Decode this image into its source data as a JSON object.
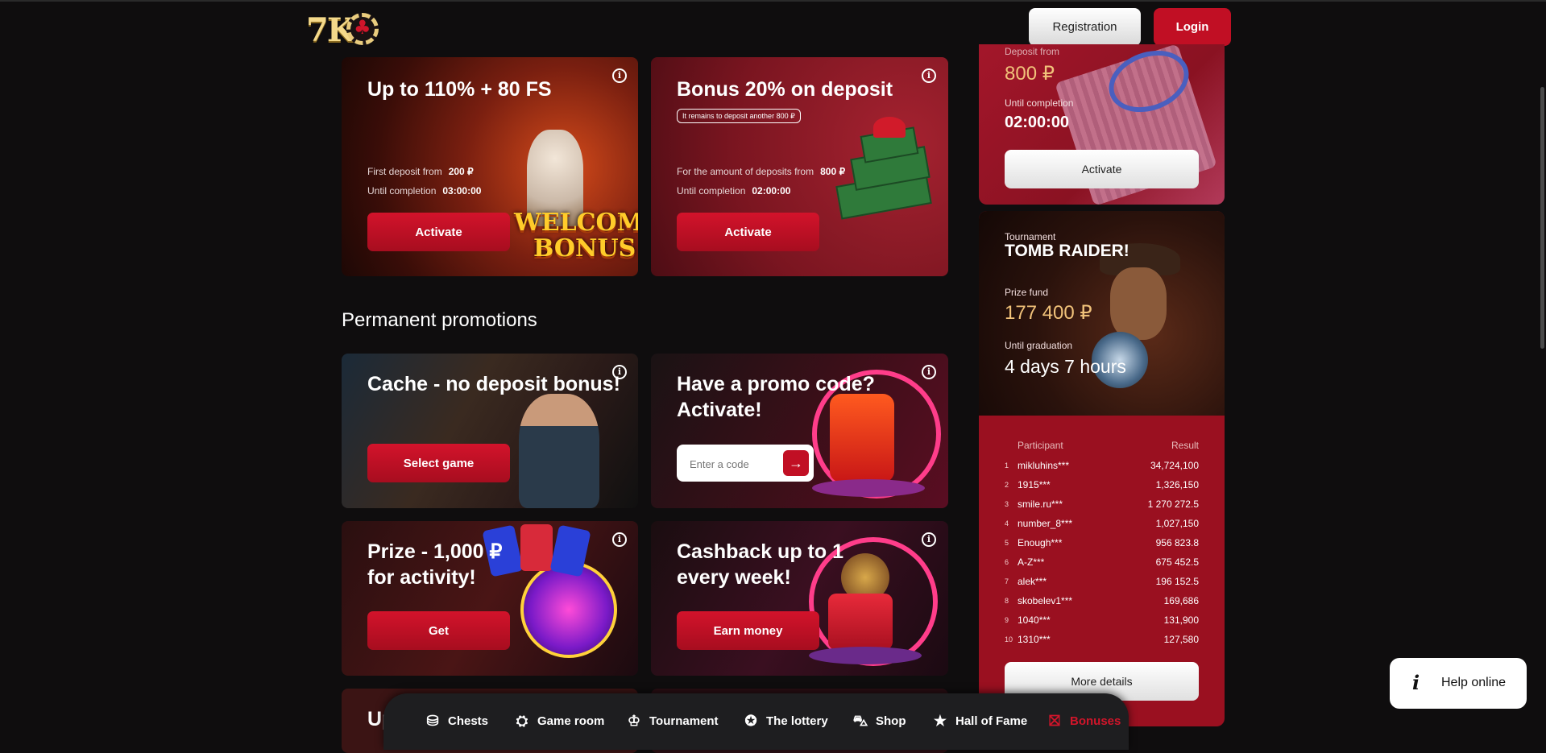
{
  "header": {
    "logo_text": "7K",
    "registration_label": "Registration",
    "login_label": "Login"
  },
  "promos_top": [
    {
      "title": "Up to 110% + 80 FS",
      "line1_label": "First deposit from",
      "line1_value": "200 ₽",
      "line2_label": "Until completion",
      "line2_value": "03:00:00",
      "button": "Activate",
      "art_text_1": "WELCOME",
      "art_text_2": "BONUS"
    },
    {
      "title": "Bonus 20% on deposit",
      "badge": "It remains to deposit another 800 ₽",
      "line1_label": "For the amount of deposits from",
      "line1_value": "800 ₽",
      "line2_label": "Until completion",
      "line2_value": "02:00:00",
      "button": "Activate"
    }
  ],
  "section_title": "Permanent promotions",
  "permanent": [
    {
      "title": "Cache - no deposit bonus!",
      "button": "Select game"
    },
    {
      "title_line1": "Have a promo code?",
      "title_line2": "Activate!",
      "input_placeholder": "Enter a code"
    },
    {
      "title_line1": "Prize - 1,000 ₽",
      "title_line2": "for activity!",
      "button": "Get"
    },
    {
      "title_line1": "Cashback up to 1",
      "title_line2": "every week!",
      "button": "Earn money"
    }
  ],
  "peek_title": "Up",
  "sidebar_bonus": {
    "top_label": "Deposit from",
    "deposit_value": "800 ₽",
    "until_label": "Until completion",
    "until_value": "02:00:00",
    "button": "Activate"
  },
  "tournament": {
    "kicker": "Tournament",
    "name": "TOMB RAIDER!",
    "prize_label": "Prize fund",
    "prize_value": "177 400 ₽",
    "until_label": "Until graduation",
    "until_days": "4 days",
    "until_hours": "7 hours",
    "col_participant": "Participant",
    "col_result": "Result",
    "rows": [
      {
        "rank": "1",
        "name": "mikluhins***",
        "result": "34,724,100"
      },
      {
        "rank": "2",
        "name": "1915***",
        "result": "1,326,150"
      },
      {
        "rank": "3",
        "name": "smile.ru***",
        "result": "1 270 272.5"
      },
      {
        "rank": "4",
        "name": "number_8***",
        "result": "1,027,150"
      },
      {
        "rank": "5",
        "name": "Enough***",
        "result": "956 823.8"
      },
      {
        "rank": "6",
        "name": "A-Z***",
        "result": "675 452.5"
      },
      {
        "rank": "7",
        "name": "alek***",
        "result": "196 152.5"
      },
      {
        "rank": "8",
        "name": "skobelev1***",
        "result": "169,686"
      },
      {
        "rank": "9",
        "name": "1040***",
        "result": "131,900"
      },
      {
        "rank": "10",
        "name": "1310***",
        "result": "127,580"
      }
    ],
    "button": "More details"
  },
  "help": {
    "icon_glyph": "i",
    "label": "Help online"
  },
  "bottom_nav": [
    {
      "label": "Chests",
      "icon": "chest-icon",
      "glyph": "⛁"
    },
    {
      "label": "Game room",
      "icon": "poker-chip-icon",
      "glyph": "⛭"
    },
    {
      "label": "Tournament",
      "icon": "trophy-icon",
      "glyph": "♔"
    },
    {
      "label": "The lottery",
      "icon": "ticket-icon",
      "glyph": "✪"
    },
    {
      "label": "Shop",
      "icon": "bag-icon",
      "glyph": "⛍"
    },
    {
      "label": "Hall of Fame",
      "icon": "star-figure-icon",
      "glyph": "★"
    },
    {
      "label": "Bonuses",
      "icon": "gift-icon",
      "glyph": "⛝"
    }
  ],
  "colors": {
    "accent": "#c10f24",
    "gold": "#f1c27a",
    "background": "#0f0d0e"
  }
}
